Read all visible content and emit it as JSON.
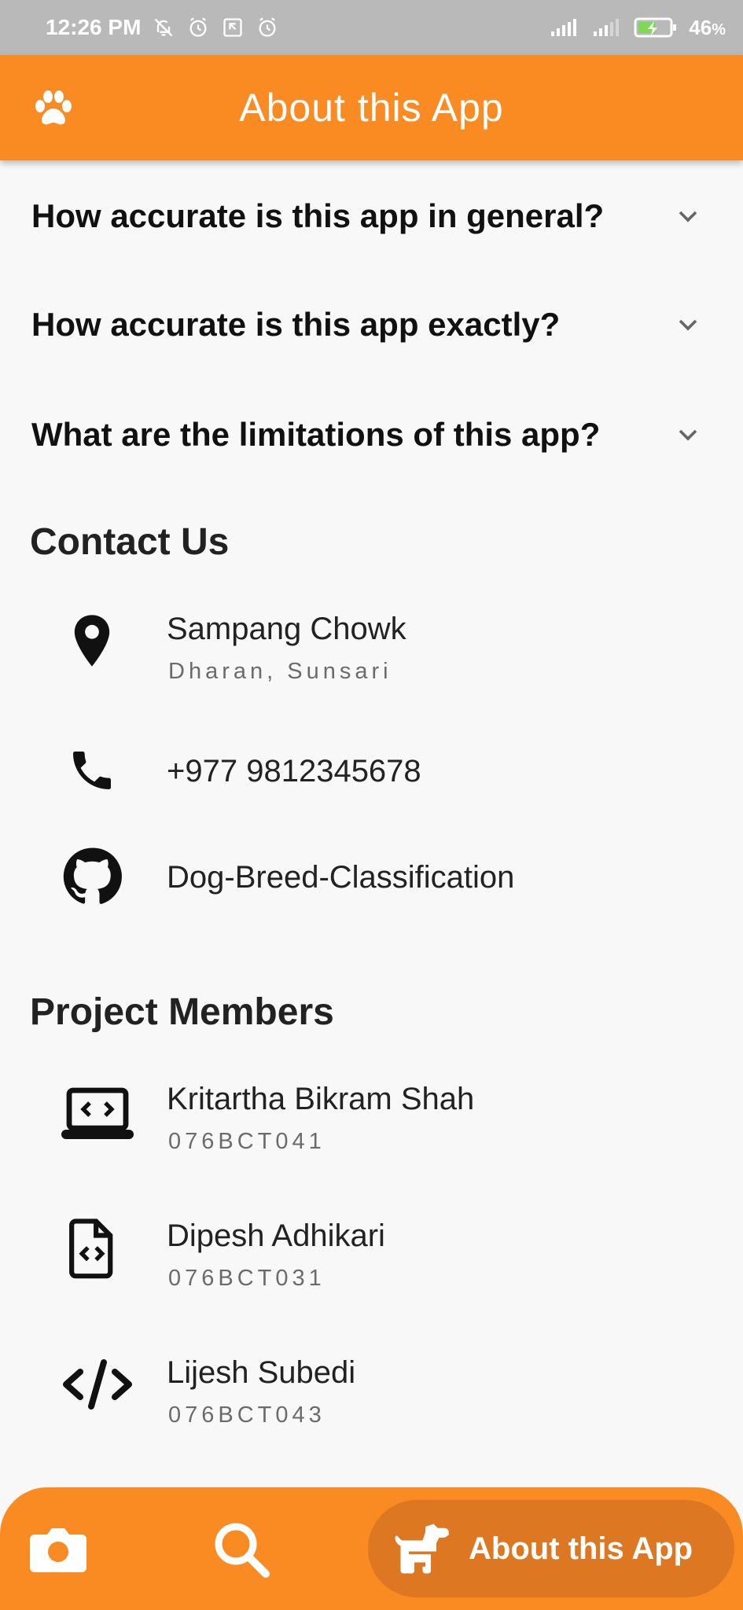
{
  "status_bar": {
    "time": "12:26 PM",
    "battery_percent": "46",
    "battery_unit": "%",
    "icons": [
      "notifications-off-icon",
      "alarm-icon",
      "screenshot-icon",
      "alarm-icon",
      "signal-icon",
      "signal-icon",
      "battery-charging-icon"
    ]
  },
  "appbar": {
    "title": "About this App",
    "icon": "paw-icon"
  },
  "faq": [
    {
      "question": "How accurate is this app in general?",
      "icon": "chevron-down-icon"
    },
    {
      "question": "How accurate is this app exactly?",
      "icon": "chevron-down-icon"
    },
    {
      "question": "What are the limitations of this app?",
      "icon": "chevron-down-icon"
    }
  ],
  "contact": {
    "title": "Contact Us",
    "items": [
      {
        "title": "Sampang Chowk",
        "subtitle": "Dharan, Sunsari",
        "icon": "location-pin-icon"
      },
      {
        "title": "+977 9812345678",
        "icon": "phone-icon"
      },
      {
        "title": "Dog-Breed-Classification",
        "icon": "github-icon"
      }
    ]
  },
  "members": {
    "title": "Project Members",
    "items": [
      {
        "name": "Kritartha Bikram Shah",
        "id": "076BCT041",
        "icon": "laptop-code-icon"
      },
      {
        "name": "Dipesh Adhikari",
        "id": "076BCT031",
        "icon": "file-code-icon"
      },
      {
        "name": "Lijesh Subedi",
        "id": "076BCT043",
        "icon": "code-icon"
      }
    ]
  },
  "bottom_nav": {
    "items": [
      {
        "icon": "camera-icon"
      },
      {
        "icon": "search-icon"
      },
      {
        "icon": "dog-icon",
        "label": "About this App",
        "active": true
      }
    ]
  },
  "colors": {
    "primary": "#fa8b22",
    "primary_dark": "#dd7722",
    "background": "#f8f8f8",
    "status_bar": "#b9b9b9"
  }
}
